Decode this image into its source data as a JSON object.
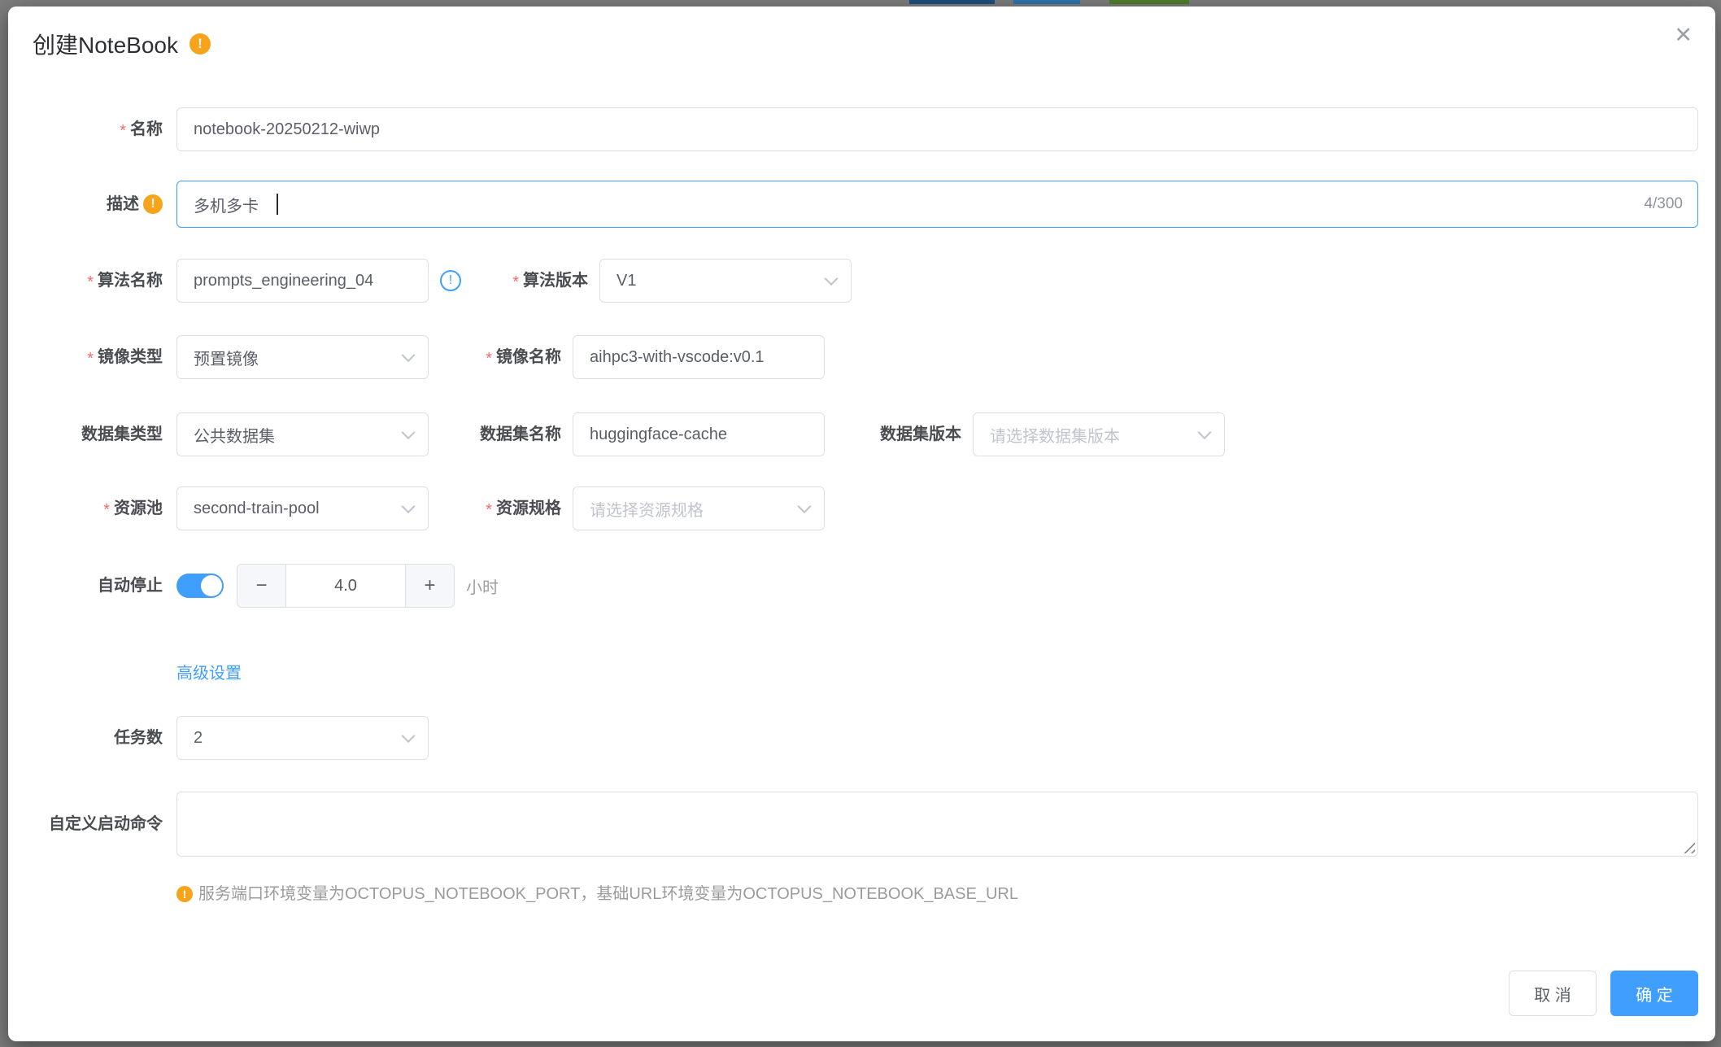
{
  "dialog": {
    "title": "创建NoteBook"
  },
  "icons": {
    "close": "✕",
    "warning": "!",
    "info": "!",
    "minus": "−",
    "plus": "+",
    "required_marker": "*"
  },
  "fields": {
    "name": {
      "label": "名称",
      "value": "notebook-20250212-wiwp"
    },
    "description": {
      "label": "描述",
      "value": "多机多卡",
      "counter": "4/300"
    },
    "algorithm_name": {
      "label": "算法名称",
      "value": "prompts_engineering_04"
    },
    "algorithm_version": {
      "label": "算法版本",
      "value": "V1"
    },
    "image_type": {
      "label": "镜像类型",
      "value": "预置镜像"
    },
    "image_name": {
      "label": "镜像名称",
      "value": "aihpc3-with-vscode:v0.1"
    },
    "dataset_type": {
      "label": "数据集类型",
      "value": "公共数据集"
    },
    "dataset_name": {
      "label": "数据集名称",
      "value": "huggingface-cache"
    },
    "dataset_version": {
      "label": "数据集版本",
      "placeholder": "请选择数据集版本"
    },
    "resource_pool": {
      "label": "资源池",
      "value": "second-train-pool"
    },
    "resource_spec": {
      "label": "资源规格",
      "placeholder": "请选择资源规格"
    },
    "auto_stop": {
      "label": "自动停止",
      "value": "4.0",
      "unit": "小时"
    },
    "advanced": {
      "label": "高级设置"
    },
    "task_count": {
      "label": "任务数",
      "value": "2"
    },
    "custom_command": {
      "label": "自定义启动命令",
      "value": ""
    },
    "hint": {
      "text": "服务端口环境变量为OCTOPUS_NOTEBOOK_PORT，基础URL环境变量为OCTOPUS_NOTEBOOK_BASE_URL"
    }
  },
  "footer": {
    "cancel": "取 消",
    "confirm": "确 定"
  },
  "colors": {
    "primary": "#409EFF",
    "warning": "#F8A41B",
    "danger": "#F56C6C",
    "border": "#DCDFE6",
    "placeholder": "#C0C4CC"
  }
}
